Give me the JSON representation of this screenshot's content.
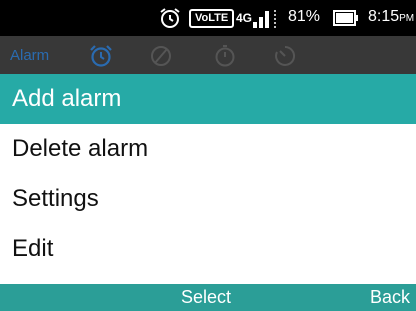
{
  "status_bar": {
    "volte": "VoLTE",
    "network": "4G",
    "battery_percent": "81%",
    "time": "8:15",
    "ampm": "PM",
    "icons": [
      "alarm-clock-icon",
      "signal-icon",
      "battery-icon"
    ]
  },
  "app_bar": {
    "title": "Alarm",
    "tabs": [
      {
        "name": "alarm-tab",
        "icon": "alarm-clock-icon",
        "active": true
      },
      {
        "name": "world-clock-tab",
        "icon": "globe-icon",
        "active": false
      },
      {
        "name": "stopwatch-tab",
        "icon": "stopwatch-icon",
        "active": false
      },
      {
        "name": "timer-tab",
        "icon": "timer-icon",
        "active": false
      }
    ]
  },
  "menu": {
    "items": [
      {
        "label": "Add alarm",
        "selected": true
      },
      {
        "label": "Delete alarm",
        "selected": false
      },
      {
        "label": "Settings",
        "selected": false
      },
      {
        "label": "Edit",
        "selected": false
      }
    ]
  },
  "softkeys": {
    "center": "Select",
    "right": "Back"
  },
  "colors": {
    "accent": "#26aaa6",
    "softkey_bar": "#2b9e97",
    "tab_active": "#2a6bb0"
  }
}
